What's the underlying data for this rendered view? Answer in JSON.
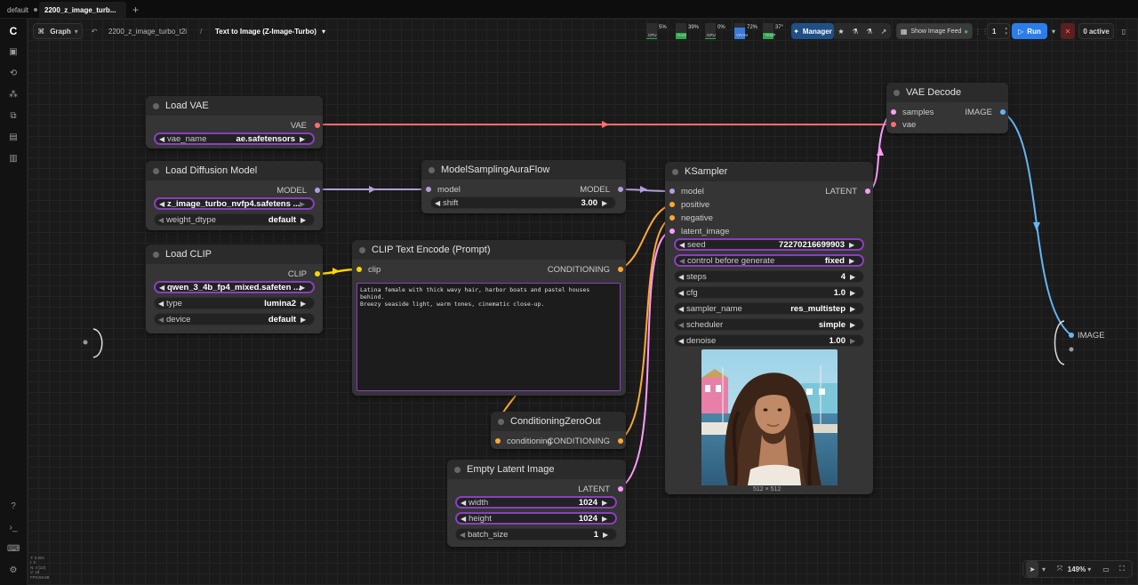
{
  "tabs": [
    {
      "label": "default"
    },
    {
      "label": "2200_z_image_turb..."
    }
  ],
  "toolbar": {
    "mode": "Graph",
    "workflow_file": "2200_z_image_turbo_t2i",
    "separator": "/",
    "workflow_name": "Text to Image (Z-Image-Turbo)",
    "stats": [
      {
        "label": "CPU",
        "pct": "5%",
        "level": 0.05,
        "color": "#2aa84a"
      },
      {
        "label": "RAM",
        "pct": "39%",
        "level": 0.39,
        "color": "#2aa84a"
      },
      {
        "label": "GPU",
        "pct": "0%",
        "level": 0.0,
        "color": "#2aa84a"
      },
      {
        "label": "VRAM",
        "pct": "72%",
        "level": 0.72,
        "color": "#3a7bd5"
      },
      {
        "label": "TEMP",
        "pct": "37°",
        "level": 0.37,
        "color": "#2aa84a"
      }
    ],
    "manager": "Manager",
    "show_feed": "Show Image Feed",
    "queue_count": "1",
    "run": "Run",
    "active": "0 active"
  },
  "nodes": {
    "load_vae": {
      "title": "Load VAE",
      "out_vae": "VAE",
      "vae_name_label": "vae_name",
      "vae_name_value": "ae.safetensors"
    },
    "load_diffusion": {
      "title": "Load Diffusion Model",
      "out_model": "MODEL",
      "unet_name_value": "z_image_turbo_nvfp4.safetens ...",
      "weight_dtype_label": "weight_dtype",
      "weight_dtype_value": "default"
    },
    "load_clip": {
      "title": "Load CLIP",
      "out_clip": "CLIP",
      "clip_name_value": "qwen_3_4b_fp4_mixed.safeten ...",
      "type_label": "type",
      "type_value": "lumina2",
      "device_label": "device",
      "device_value": "default"
    },
    "model_sampling": {
      "title": "ModelSamplingAuraFlow",
      "in_model": "model",
      "out_model": "MODEL",
      "shift_label": "shift",
      "shift_value": "3.00"
    },
    "clip_text_encode": {
      "title": "CLIP Text Encode (Prompt)",
      "in_clip": "clip",
      "out_cond": "CONDITIONING",
      "prompt_line1": "Latina female with thick wavy hair, harbor boats and pastel houses behind.",
      "prompt_line2": "Breezy seaside light, warm tones, cinematic close-up."
    },
    "cond_zero_out": {
      "title": "ConditioningZeroOut",
      "in_cond": "conditioning",
      "out_cond": "CONDITIONING"
    },
    "empty_latent": {
      "title": "Empty Latent Image",
      "out_latent": "LATENT",
      "width_label": "width",
      "width_value": "1024",
      "height_label": "height",
      "height_value": "1024",
      "batch_label": "batch_size",
      "batch_value": "1"
    },
    "ksampler": {
      "title": "KSampler",
      "in_model": "model",
      "in_positive": "positive",
      "in_negative": "negative",
      "in_latent": "latent_image",
      "out_latent": "LATENT",
      "widgets": [
        {
          "label": "seed",
          "value": "72270216699903"
        },
        {
          "label": "control before generate",
          "value": "fixed"
        },
        {
          "label": "steps",
          "value": "4"
        },
        {
          "label": "cfg",
          "value": "1.0"
        },
        {
          "label": "sampler_name",
          "value": "res_multistep"
        },
        {
          "label": "scheduler",
          "value": "simple"
        },
        {
          "label": "denoise",
          "value": "1.00"
        }
      ],
      "preview_caption": "512 × 512"
    },
    "vae_decode": {
      "title": "VAE Decode",
      "in_samples": "samples",
      "in_vae": "vae",
      "out_image": "IMAGE"
    },
    "output_group": {
      "label": "IMAGE"
    }
  },
  "status": {
    "lines": [
      "T: 0.00s",
      "I: 0",
      "N: 4 [10]",
      "V: 18",
      "FPS:59.88"
    ]
  },
  "view": {
    "zoom": "149%"
  },
  "colors": {
    "vae": "#ff6e6e",
    "model": "#b39ddb",
    "clip": "#ffd500",
    "conditioning": "#ffa931",
    "latent": "#ff9cf9",
    "image": "#64b5f6",
    "accent_run": "#2b7de9",
    "widget_highlight": "#8a3fbf"
  }
}
